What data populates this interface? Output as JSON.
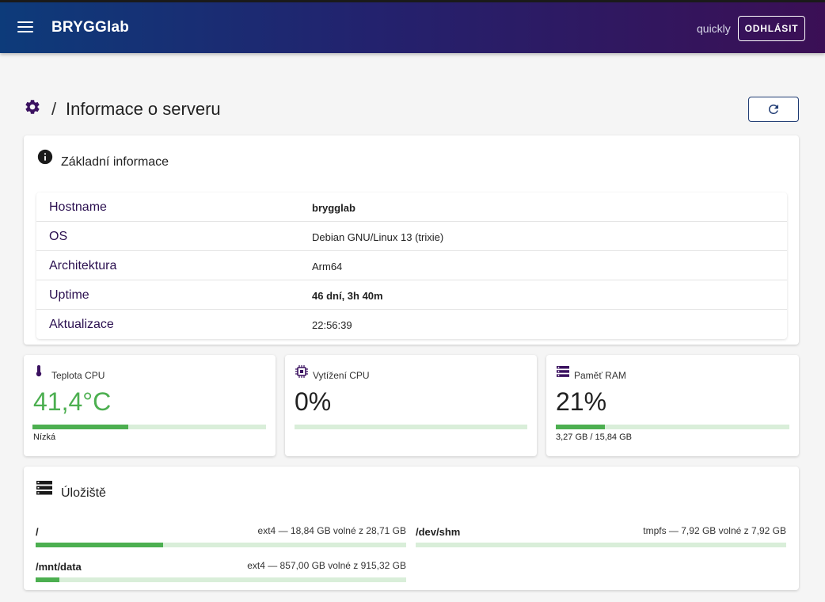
{
  "app": {
    "title": "BRYGGlab",
    "user": "quickly",
    "logout_label": "ODHLÁSIT"
  },
  "page": {
    "breadcrumb_separator": "/",
    "title": "Informace o serveru"
  },
  "basic_info": {
    "title": "Základní informace",
    "rows": [
      {
        "key": "Hostname",
        "value": "brygglab",
        "bold": true
      },
      {
        "key": "OS",
        "value": "Debian GNU/Linux 13 (trixie)",
        "bold": false
      },
      {
        "key": "Architektura",
        "value": "Arm64",
        "bold": false
      },
      {
        "key": "Uptime",
        "value": "46 dní, 3h 40m",
        "bold": true
      },
      {
        "key": "Aktualizace",
        "value": "22:56:39",
        "bold": false
      }
    ]
  },
  "metrics": {
    "cpu_temp": {
      "label": "Teplota CPU",
      "value": "41,4°C",
      "level_fraction": 0.41,
      "status": "Nízká",
      "color": "#4caf50"
    },
    "cpu_load": {
      "label": "Vytížení CPU",
      "value": "0%",
      "level_fraction": 0.0
    },
    "ram": {
      "label": "Paměť RAM",
      "value": "21%",
      "level_fraction": 0.21,
      "detail": "3,27 GB / 15,84 GB"
    }
  },
  "storage": {
    "title": "Úložiště",
    "volumes": [
      {
        "mount": "/",
        "detail": "ext4 — 18,84 GB volné z 28,71 GB",
        "used_fraction": 0.344
      },
      {
        "mount": "/dev/shm",
        "detail": "tmpfs — 7,92 GB volné z 7,92 GB",
        "used_fraction": 0.0
      },
      {
        "mount": "/mnt/data",
        "detail": "ext4 — 857,00 GB volné z 915,32 GB",
        "used_fraction": 0.064
      }
    ]
  },
  "icons": {
    "menu": "menu-icon",
    "settings": "gear-icon",
    "refresh": "refresh-icon",
    "info": "info-icon",
    "thermometer": "thermometer-icon",
    "cpu": "cpu-chip-icon",
    "memory": "memory-icon",
    "storage": "storage-icon"
  },
  "colors": {
    "accent": "#3b1260",
    "success": "#4caf50",
    "success_track": "#d9eed9"
  }
}
